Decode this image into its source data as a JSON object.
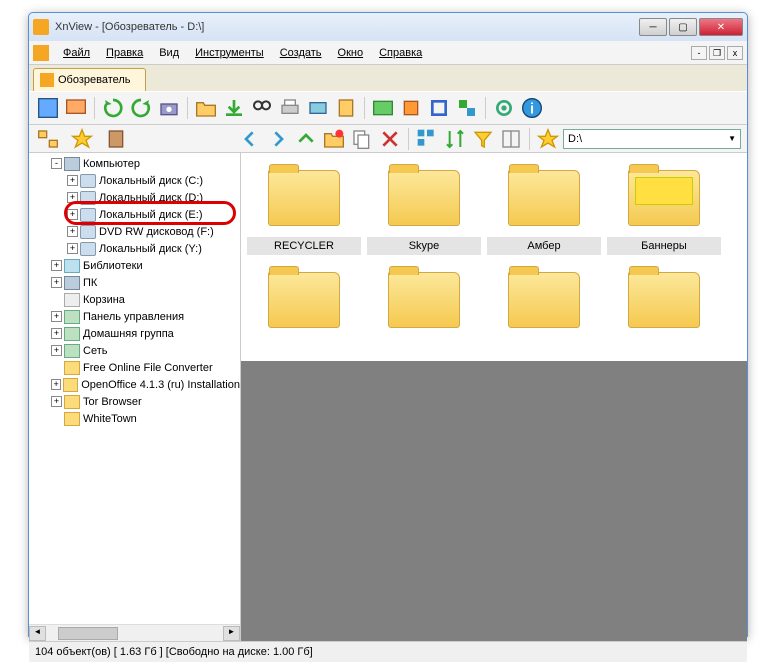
{
  "title": "XnView - [Обозреватель - D:\\]",
  "menu": {
    "file": "Файл",
    "edit": "Правка",
    "view": "Вид",
    "tools": "Инструменты",
    "create": "Создать",
    "window": "Окно",
    "help": "Справка"
  },
  "tab": {
    "label": "Обозреватель"
  },
  "address": "D:\\",
  "tree": [
    {
      "level": 2,
      "exp": "-",
      "icon": "comp",
      "label": "Компьютер"
    },
    {
      "level": 3,
      "exp": "+",
      "icon": "drive",
      "label": "Локальный диск (C:)"
    },
    {
      "level": 3,
      "exp": "+",
      "icon": "drive",
      "label": "Локальный диск (D:)",
      "hl": true
    },
    {
      "level": 3,
      "exp": "+",
      "icon": "drive",
      "label": "Локальный диск (E:)"
    },
    {
      "level": 3,
      "exp": "+",
      "icon": "drive",
      "label": "DVD RW дисковод (F:)"
    },
    {
      "level": 3,
      "exp": "+",
      "icon": "drive",
      "label": "Локальный диск (Y:)"
    },
    {
      "level": 2,
      "exp": "+",
      "icon": "lib",
      "label": "Библиотеки"
    },
    {
      "level": 2,
      "exp": "+",
      "icon": "comp",
      "label": "ПК"
    },
    {
      "level": 2,
      "exp": "",
      "icon": "bin",
      "label": "Корзина"
    },
    {
      "level": 2,
      "exp": "+",
      "icon": "net",
      "label": "Панель управления"
    },
    {
      "level": 2,
      "exp": "+",
      "icon": "net",
      "label": "Домашняя группа"
    },
    {
      "level": 2,
      "exp": "+",
      "icon": "net",
      "label": "Сеть"
    },
    {
      "level": 2,
      "exp": "",
      "icon": "folder",
      "label": "Free Online File Converter"
    },
    {
      "level": 2,
      "exp": "+",
      "icon": "folder",
      "label": "OpenOffice 4.1.3 (ru) Installation"
    },
    {
      "level": 2,
      "exp": "+",
      "icon": "folder",
      "label": "Tor Browser"
    },
    {
      "level": 2,
      "exp": "",
      "icon": "folder",
      "label": "WhiteTown"
    }
  ],
  "thumbs": [
    {
      "label": "RECYCLER",
      "type": "folder"
    },
    {
      "label": "Skype",
      "type": "folder"
    },
    {
      "label": "Амбер",
      "type": "folder"
    },
    {
      "label": "Баннеры",
      "type": "banner"
    },
    {
      "label": "",
      "type": "folder"
    },
    {
      "label": "",
      "type": "folder"
    },
    {
      "label": "",
      "type": "folder"
    },
    {
      "label": "",
      "type": "folder"
    }
  ],
  "status": {
    "objects": "104 объект(ов)",
    "size": "[ 1.63 Гб ]",
    "free": "[Свободно на диске: 1.00 Гб]"
  },
  "toolbar_icons": [
    "fullscreen",
    "slideshow",
    "refresh-cw",
    "refresh-ccw",
    "camera",
    "open",
    "save",
    "binoculars",
    "print",
    "scanner",
    "clipboard",
    "image",
    "rotate",
    "crop",
    "convert",
    "settings",
    "info"
  ],
  "toolbar2_left_icons": [
    "tree",
    "favorites",
    "categories"
  ],
  "toolbar2_nav_icons": [
    "back",
    "forward",
    "up",
    "new-folder",
    "copy",
    "delete",
    "view-mode",
    "sort",
    "filter",
    "layout",
    "star"
  ]
}
